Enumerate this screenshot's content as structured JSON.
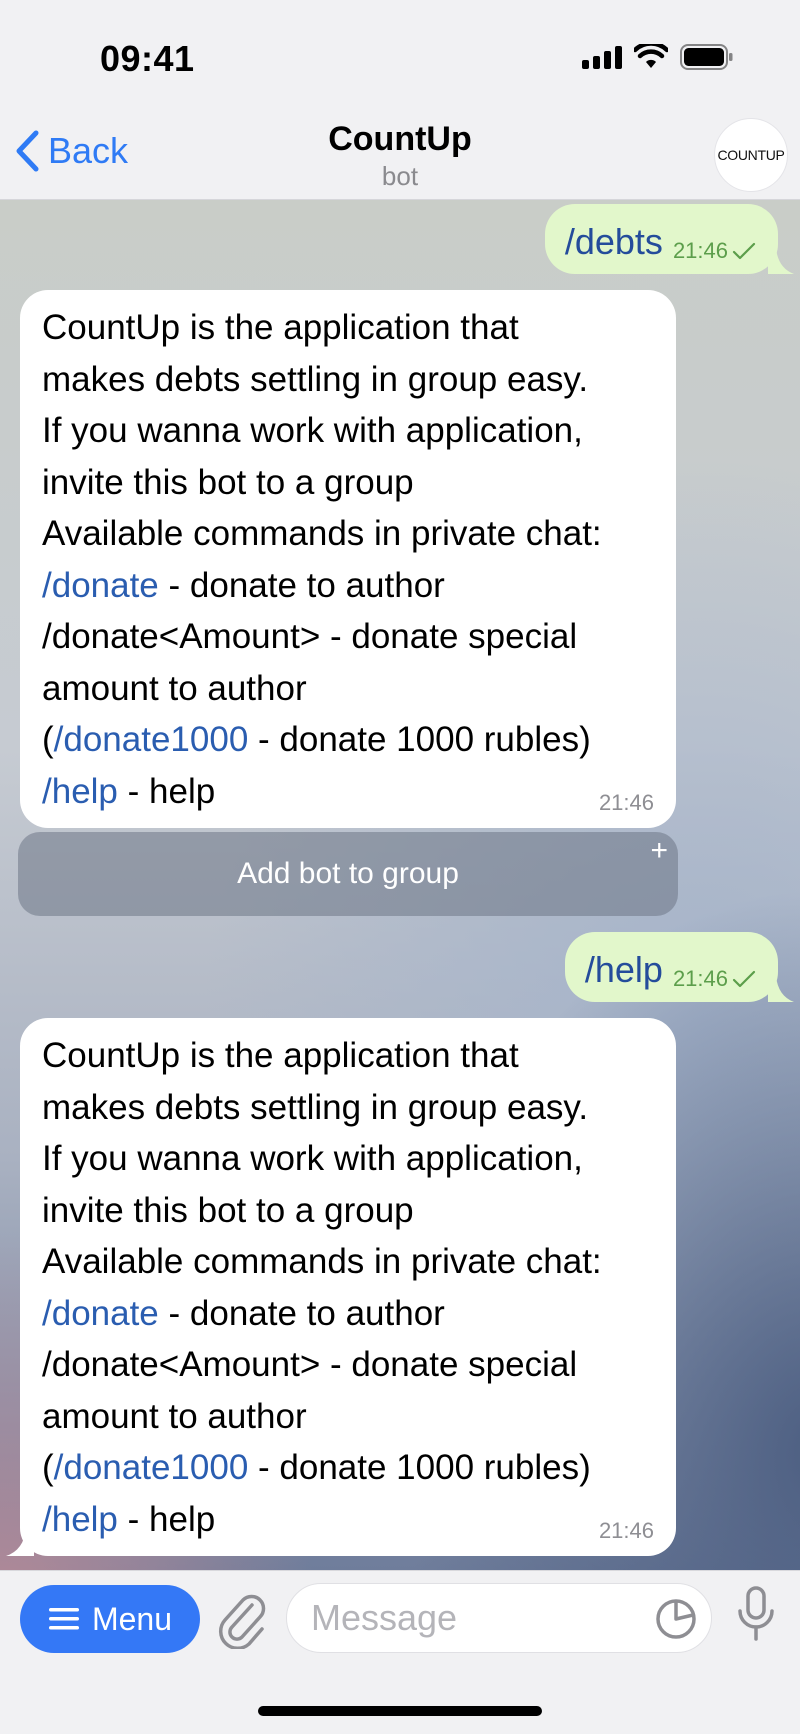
{
  "status_bar": {
    "time": "09:41"
  },
  "header": {
    "back_label": "Back",
    "title": "CountUp",
    "subtitle": "bot",
    "avatar_text": "COUNTUP"
  },
  "messages": [
    {
      "kind": "outgoing",
      "text": "/debts",
      "time": "21:46"
    },
    {
      "kind": "incoming",
      "lines": [
        "CountUp is the application that",
        "makes debts settling in group easy.",
        "If you wanna work with application,",
        "invite this bot to a group",
        "Available commands in private chat:"
      ],
      "donate_cmd": "/donate",
      "donate_desc": " - donate to author",
      "donate_amount_line": "/donate<Amount> - donate special",
      "donate_amount_line2": "amount to author",
      "paren_open": "(",
      "donate1000_cmd": "/donate1000",
      "donate1000_desc": " - donate 1000 rubles)",
      "help_cmd": "/help",
      "help_desc": " - help",
      "time": "21:46"
    },
    {
      "kind": "outgoing",
      "text": "/help",
      "time": "21:46"
    },
    {
      "kind": "incoming",
      "lines": [
        "CountUp is the application that",
        "makes debts settling in group easy.",
        "If you wanna work with application,",
        "invite this bot to a group",
        "Available commands in private chat:"
      ],
      "donate_cmd": "/donate",
      "donate_desc": " - donate to author",
      "donate_amount_line": "/donate<Amount> - donate special",
      "donate_amount_line2": "amount to author",
      "paren_open": "(",
      "donate1000_cmd": "/donate1000",
      "donate1000_desc": " - donate 1000 rubles)",
      "help_cmd": "/help",
      "help_desc": " - help",
      "time": "21:46"
    }
  ],
  "inline_button": {
    "label": "Add bot to group",
    "plus": "+"
  },
  "composer": {
    "menu_label": "Menu",
    "placeholder": "Message"
  },
  "colors": {
    "accent": "#3478f6",
    "link": "#2a5db0",
    "outgoing_bubble": "#e2f7cb",
    "checkmark": "#5c9e4b"
  },
  "icons": [
    "chevron-left-icon",
    "signal-icon",
    "wifi-icon",
    "battery-icon",
    "menu-icon",
    "paperclip-icon",
    "sticker-icon",
    "microphone-icon",
    "checkmark-icon"
  ]
}
